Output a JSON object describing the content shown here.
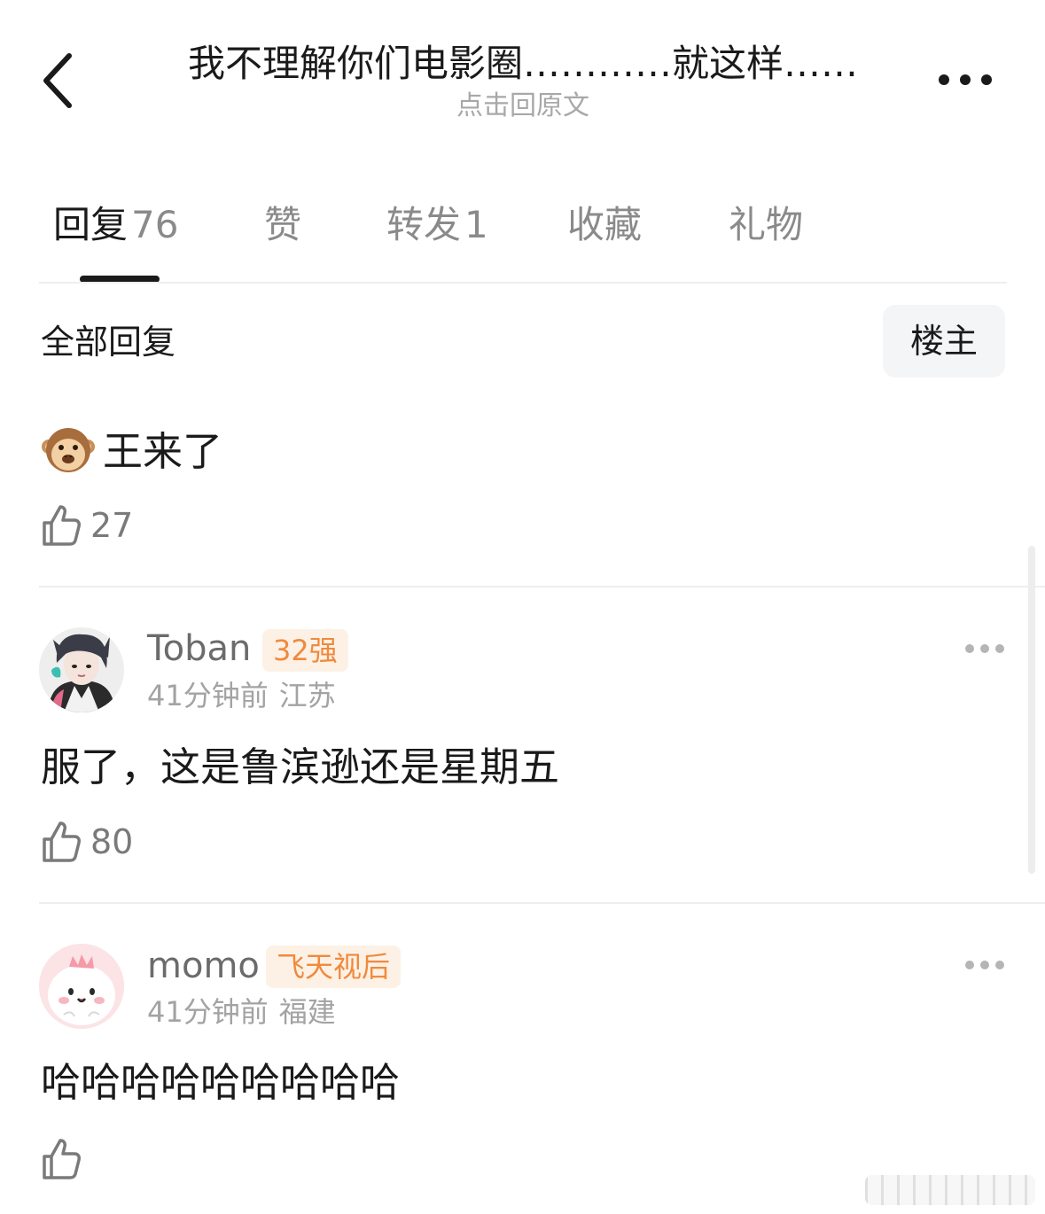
{
  "header": {
    "title": "我不理解你们电影圈…………就这样……",
    "subtitle": "点击回原文",
    "back_icon": "chevron-left-icon",
    "more_icon": "more-horizontal-icon"
  },
  "tabs": [
    {
      "label": "回复",
      "count": "76",
      "active": true
    },
    {
      "label": "赞",
      "count": "",
      "active": false
    },
    {
      "label": "转发",
      "count": "1",
      "active": false
    },
    {
      "label": "收藏",
      "count": "",
      "active": false
    },
    {
      "label": "礼物",
      "count": "",
      "active": false
    }
  ],
  "filter": {
    "title": "全部回复",
    "op_button": "楼主"
  },
  "comments": [
    {
      "text": "王来了",
      "emoji_icon": "see-no-evil-monkey-icon",
      "likes": "27"
    },
    {
      "username": "Toban",
      "badge": "32强",
      "time": "41分钟前",
      "location": "江苏",
      "text": "服了，这是鲁滨逊还是星期五",
      "likes": "80"
    },
    {
      "username": "momo",
      "badge": "飞天视后",
      "time": "41分钟前",
      "location": "福建",
      "text": "哈哈哈哈哈哈哈哈哈",
      "likes": ""
    }
  ],
  "colors": {
    "badge_bg": "#fdf1e6",
    "badge_text": "#f08a3c",
    "subtitle": "#a8a8a8",
    "tab_inactive": "#8a8a8a"
  }
}
